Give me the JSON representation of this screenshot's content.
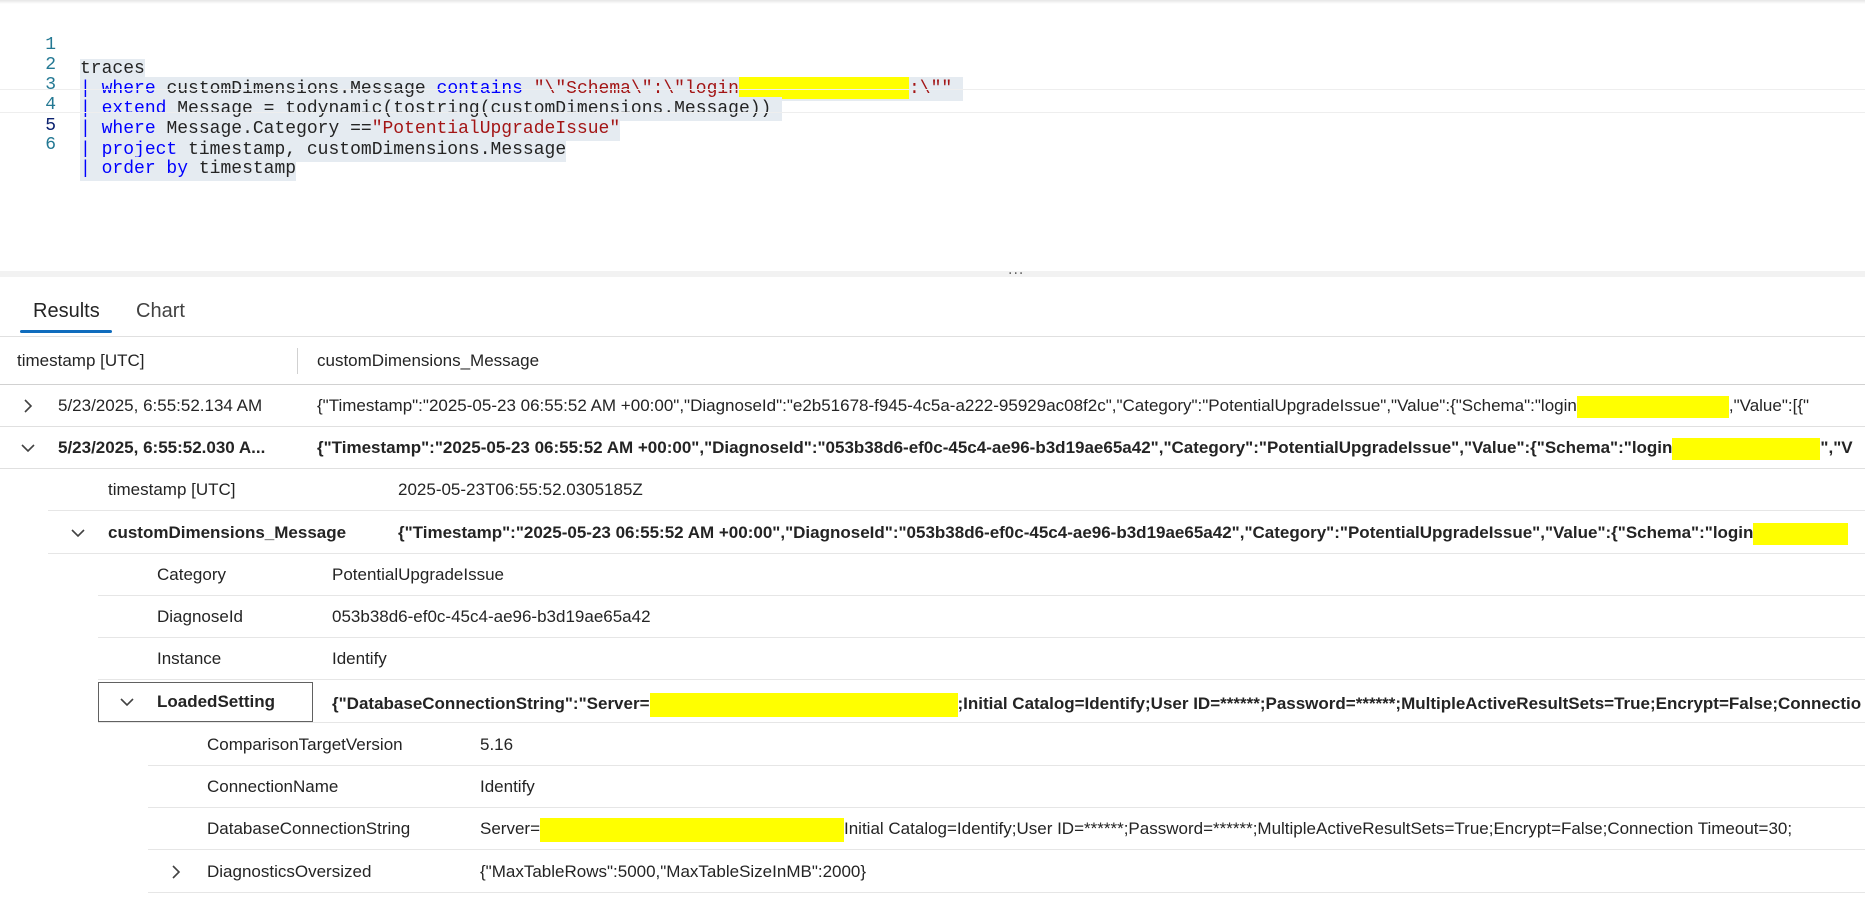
{
  "editor": {
    "lines": [
      {
        "num": "1",
        "code": "traces"
      },
      {
        "num": "2",
        "pipe": "|",
        "kw": "where",
        "code": "customDimensions.Message",
        "kw2": "contains",
        "str": "\"\\\"Schema\\\":\\\"login",
        "str2": ":\\\"\""
      },
      {
        "num": "3",
        "pipe": "|",
        "kw": "extend",
        "code": "Message = todynamic(tostring(customDimensions.Message))"
      },
      {
        "num": "4",
        "pipe": "|",
        "kw": "where",
        "code": "Message.Category ==",
        "str": "\"PotentialUpgradeIssue\""
      },
      {
        "num": "5",
        "pipe": "|",
        "kw": "project",
        "code": "timestamp, customDimensions.Message"
      },
      {
        "num": "6",
        "pipe": "|",
        "kw": "order by",
        "code": "timestamp"
      }
    ]
  },
  "splitter": {
    "handle": "..."
  },
  "tabs": {
    "results": "Results",
    "chart": "Chart"
  },
  "grid": {
    "columns": {
      "timestamp": "timestamp [UTC]",
      "message": "customDimensions_Message"
    },
    "rows": [
      {
        "timestamp": "5/23/2025, 6:55:52.134 AM",
        "message": "{\"Timestamp\":\"2025-05-23 06:55:52 AM +00:00\",\"DiagnoseId\":\"e2b51678-f945-4c5a-a222-95929ac08f2c\",\"Category\":\"PotentialUpgradeIssue\",\"Value\":{\"Schema\":\"login",
        "message_tail": ",\"Value\":[{\""
      },
      {
        "timestamp": "5/23/2025, 6:55:52.030 A...",
        "message": "{\"Timestamp\":\"2025-05-23 06:55:52 AM +00:00\",\"DiagnoseId\":\"053b38d6-ef0c-45c4-ae96-b3d19ae65a42\",\"Category\":\"PotentialUpgradeIssue\",\"Value\":{\"Schema\":\"login",
        "message_tail": "\",\"V"
      }
    ],
    "expanded": {
      "timestamp_label": "timestamp [UTC]",
      "timestamp_value": "2025-05-23T06:55:52.0305185Z",
      "message_label": "customDimensions_Message",
      "message_value": "{\"Timestamp\":\"2025-05-23 06:55:52 AM +00:00\",\"DiagnoseId\":\"053b38d6-ef0c-45c4-ae96-b3d19ae65a42\",\"Category\":\"PotentialUpgradeIssue\",\"Value\":{\"Schema\":\"login",
      "fields": [
        {
          "key": "Category",
          "value": "PotentialUpgradeIssue"
        },
        {
          "key": "DiagnoseId",
          "value": "053b38d6-ef0c-45c4-ae96-b3d19ae65a42"
        },
        {
          "key": "Instance",
          "value": "Identify"
        }
      ],
      "loaded_setting": {
        "key": "LoadedSetting",
        "value_prefix": "{\"DatabaseConnectionString\":\"Server=",
        "value_suffix": ";Initial Catalog=Identify;User ID=******;Password=******;MultipleActiveResultSets=True;Encrypt=False;Connectio",
        "fields": [
          {
            "key": "ComparisonTargetVersion",
            "value": "5.16"
          },
          {
            "key": "ConnectionName",
            "value": "Identify"
          },
          {
            "key": "DatabaseConnectionString",
            "value_prefix": "Server=",
            "value_suffix": "Initial Catalog=Identify;User ID=******;Password=******;MultipleActiveResultSets=True;Encrypt=False;Connection Timeout=30;"
          },
          {
            "key": "DiagnosticsOversized",
            "value": "{\"MaxTableRows\":5000,\"MaxTableSizeInMB\":2000}"
          }
        ]
      }
    }
  },
  "colors": {
    "keyword": "#0000ff",
    "string": "#a31515",
    "accent": "#0f6cbd",
    "redaction": "#ffff00",
    "line_number": "#237893"
  }
}
